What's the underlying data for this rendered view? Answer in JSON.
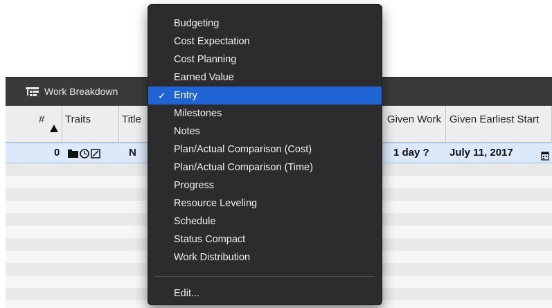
{
  "window": {
    "title": "Work Breakdown"
  },
  "table": {
    "columns": [
      {
        "label": "#"
      },
      {
        "label": "Traits"
      },
      {
        "label": "Title"
      },
      {
        "label": "Given Work"
      },
      {
        "label": "Given Earliest Start"
      }
    ],
    "sort_column": "#",
    "sort_direction": "ascending",
    "rows": [
      {
        "number": "0",
        "traits_icons": [
          "folder-icon",
          "clock-icon",
          "note-icon"
        ],
        "title": "N",
        "given_work": "1 day ?",
        "given_earliest_start": "July 11, 2017"
      }
    ]
  },
  "dropdown": {
    "items": [
      {
        "label": "Budgeting",
        "selected": false
      },
      {
        "label": "Cost Expectation",
        "selected": false
      },
      {
        "label": "Cost Planning",
        "selected": false
      },
      {
        "label": "Earned Value",
        "selected": false
      },
      {
        "label": "Entry",
        "selected": true
      },
      {
        "label": "Milestones",
        "selected": false
      },
      {
        "label": "Notes",
        "selected": false
      },
      {
        "label": "Plan/Actual Comparison (Cost)",
        "selected": false
      },
      {
        "label": "Plan/Actual Comparison (Time)",
        "selected": false
      },
      {
        "label": "Progress",
        "selected": false
      },
      {
        "label": "Resource Leveling",
        "selected": false
      },
      {
        "label": "Schedule",
        "selected": false
      },
      {
        "label": "Status Compact",
        "selected": false
      },
      {
        "label": "Work Distribution",
        "selected": false
      }
    ],
    "edit_label": "Edit...",
    "check_glyph": "✓"
  },
  "colors": {
    "menu_background": "#2c2c2e",
    "menu_selection": "#1f63d4",
    "row_selection": "#dce9fb",
    "titlebar": "#3a3a3a"
  }
}
